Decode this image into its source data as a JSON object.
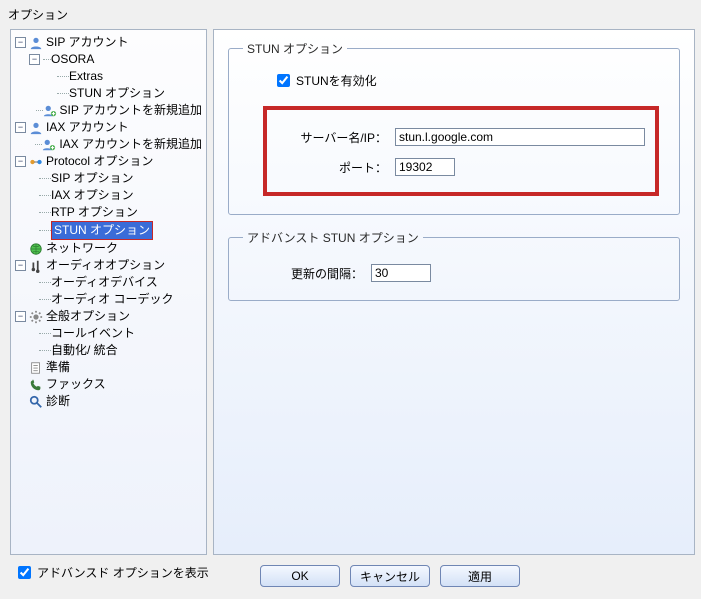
{
  "window": {
    "title": "オプション"
  },
  "tree": {
    "sip_account": "SIP アカウント",
    "osora": "OSORA",
    "extras": "Extras",
    "stun_opts_child": "STUN オプション",
    "sip_add": "SIP アカウントを新規追加",
    "iax_account": "IAX アカウント",
    "iax_add": "IAX アカウントを新規追加",
    "protocol": "Protocol オプション",
    "sip_opt": "SIP オプション",
    "iax_opt": "IAX オプション",
    "rtp_opt": "RTP オプション",
    "stun_opt": "STUN オプション",
    "network": "ネットワーク",
    "audio": "オーディオオプション",
    "audio_dev": "オーディオデバイス",
    "audio_codec": "オーディオ コーデック",
    "general": "全般オプション",
    "call_event": "コールイベント",
    "automation": "自動化/ 統合",
    "provision": "準備",
    "fax": "ファックス",
    "diag": "診断"
  },
  "stun_group": {
    "legend": "STUN オプション",
    "enable_label": "STUNを有効化",
    "server_label": "サーバー名/IP：",
    "server_value": "stun.l.google.com",
    "port_label": "ポート：",
    "port_value": "19302"
  },
  "adv_group": {
    "legend": "アドバンスト STUN オプション",
    "refresh_label": "更新の間隔：",
    "refresh_value": "30"
  },
  "footer": {
    "advanced_label": "アドバンスド オプションを表示",
    "ok": "OK",
    "cancel": "キャンセル",
    "apply": "適用"
  },
  "icons": {
    "user": "user-icon",
    "add_user": "add-user-icon",
    "protocol": "protocol-icon",
    "globe": "globe-icon",
    "audio": "audio-icon",
    "gear": "gear-icon",
    "provision": "paper-icon",
    "fax": "phone-icon",
    "diag": "magnifier-icon"
  }
}
